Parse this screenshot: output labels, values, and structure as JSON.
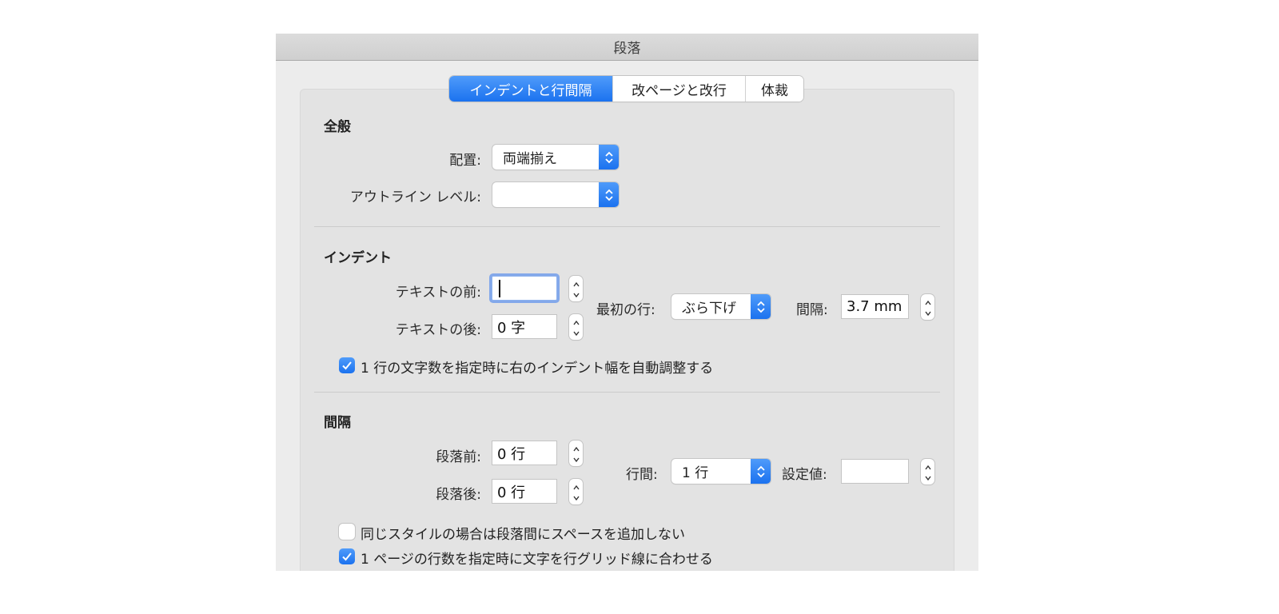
{
  "window": {
    "title": "段落"
  },
  "tabs": [
    {
      "label": "インデントと行間隔",
      "active": true
    },
    {
      "label": "改ページと改行",
      "active": false
    },
    {
      "label": "体裁",
      "active": false
    }
  ],
  "general": {
    "title": "全般",
    "alignment": {
      "label": "配置:",
      "value": "両端揃え"
    },
    "outline_level": {
      "label": "アウトライン レベル:",
      "value": ""
    }
  },
  "indent": {
    "title": "インデント",
    "before_text": {
      "label": "テキストの前:",
      "value": ""
    },
    "after_text": {
      "label": "テキストの後:",
      "value": "0 字"
    },
    "first_line": {
      "label": "最初の行:",
      "value": "ぶら下げ"
    },
    "by": {
      "label": "間隔:",
      "value": "3.7 mm"
    },
    "auto_adjust_checkbox": {
      "label": "1 行の文字数を指定時に右のインデント幅を自動調整する",
      "checked": true
    }
  },
  "spacing": {
    "title": "間隔",
    "before": {
      "label": "段落前:",
      "value": "0 行"
    },
    "after": {
      "label": "段落後:",
      "value": "0 行"
    },
    "line_spacing": {
      "label": "行間:",
      "value": "1 行"
    },
    "at": {
      "label": "設定値:",
      "value": ""
    },
    "no_space_same_style_checkbox": {
      "label": "同じスタイルの場合は段落間にスペースを追加しない",
      "checked": false
    },
    "snap_to_grid_checkbox": {
      "label": "1 ページの行数を指定時に文字を行グリッド線に合わせる",
      "checked": true
    }
  },
  "colors": {
    "accent": "#1b72ef",
    "focus_ring": "#83a8ea"
  }
}
